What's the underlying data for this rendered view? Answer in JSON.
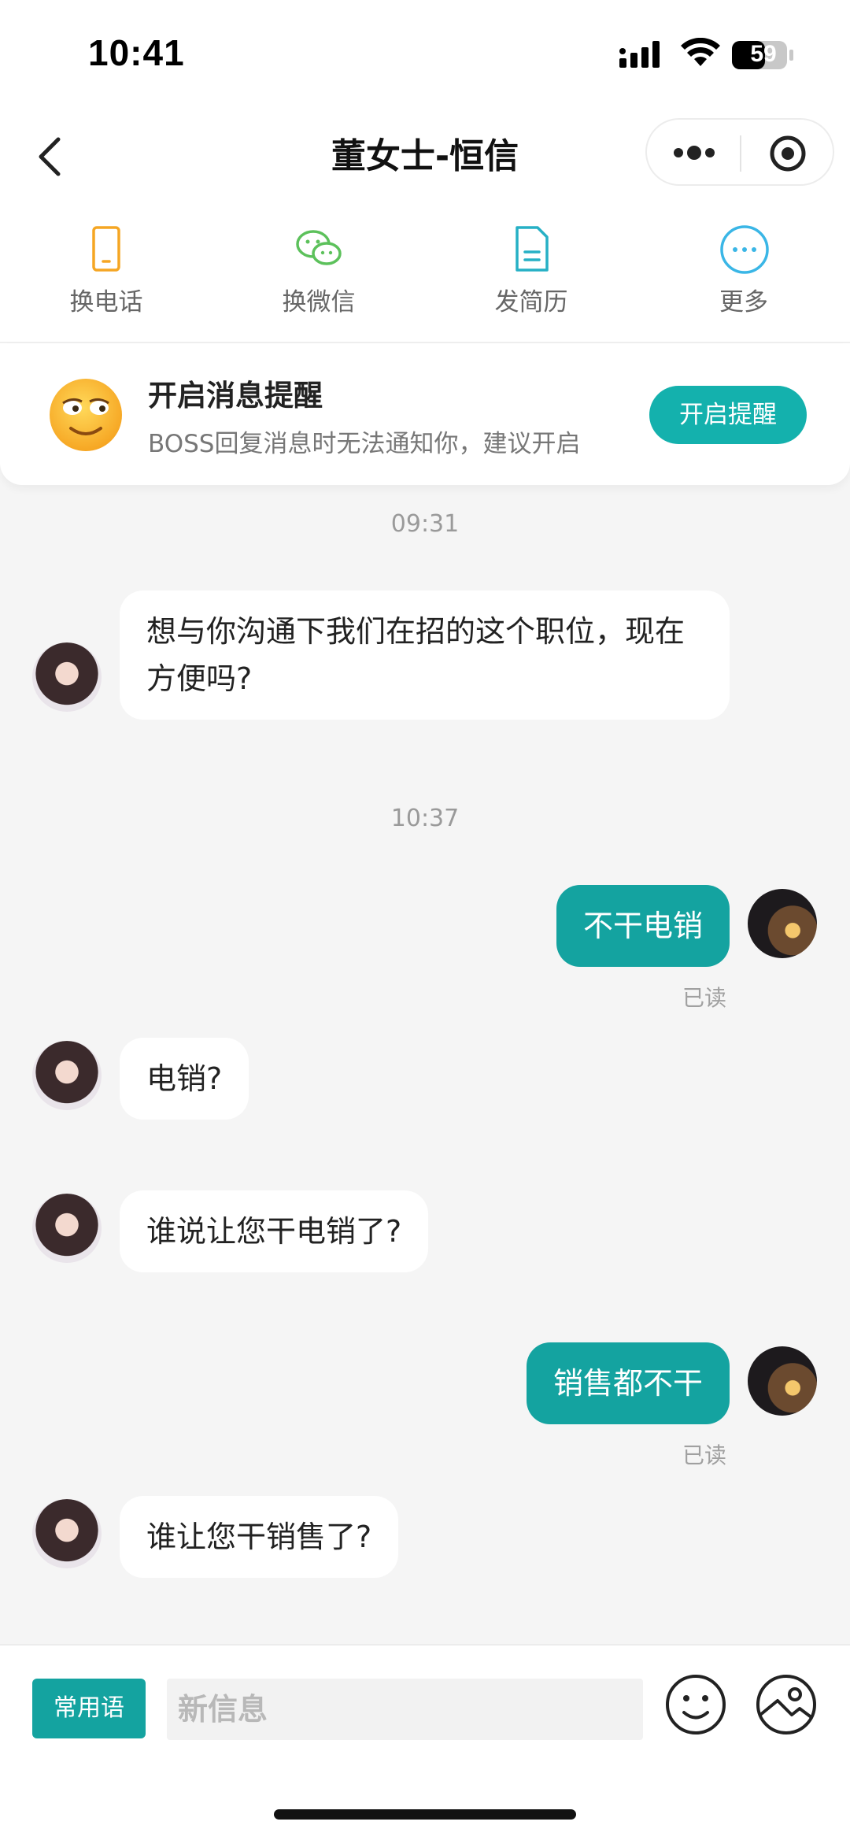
{
  "status_bar": {
    "time": "10:41",
    "battery": "59"
  },
  "nav": {
    "title": "董女士-恒信"
  },
  "actions": [
    {
      "label": "换电话",
      "icon": "phone-icon",
      "color": "#f5a623"
    },
    {
      "label": "换微信",
      "icon": "wechat-icon",
      "color": "#5cc15b"
    },
    {
      "label": "发简历",
      "icon": "resume-icon",
      "color": "#26b0c5"
    },
    {
      "label": "更多",
      "icon": "more-icon",
      "color": "#3ab6e6"
    }
  ],
  "notify": {
    "title": "开启消息提醒",
    "description": "BOSS回复消息时无法通知你，建议开启",
    "button": "开启提醒"
  },
  "chat": {
    "timestamps": [
      "09:31",
      "10:37"
    ],
    "messages": [
      {
        "side": "in",
        "text": "想与你沟通下我们在招的这个职位，现在方便吗?"
      },
      {
        "side": "out",
        "text": "不干电销",
        "status": "已读"
      },
      {
        "side": "in",
        "text": "电销?"
      },
      {
        "side": "in",
        "text": "谁说让您干电销了?"
      },
      {
        "side": "out",
        "text": "销售都不干",
        "status": "已读"
      },
      {
        "side": "in",
        "text": "谁让您干销售了?"
      }
    ]
  },
  "input_bar": {
    "phrases_button": "常用语",
    "placeholder": "新信息"
  },
  "colors": {
    "accent": "#14a3a0",
    "notify_button": "#14b1ad"
  }
}
